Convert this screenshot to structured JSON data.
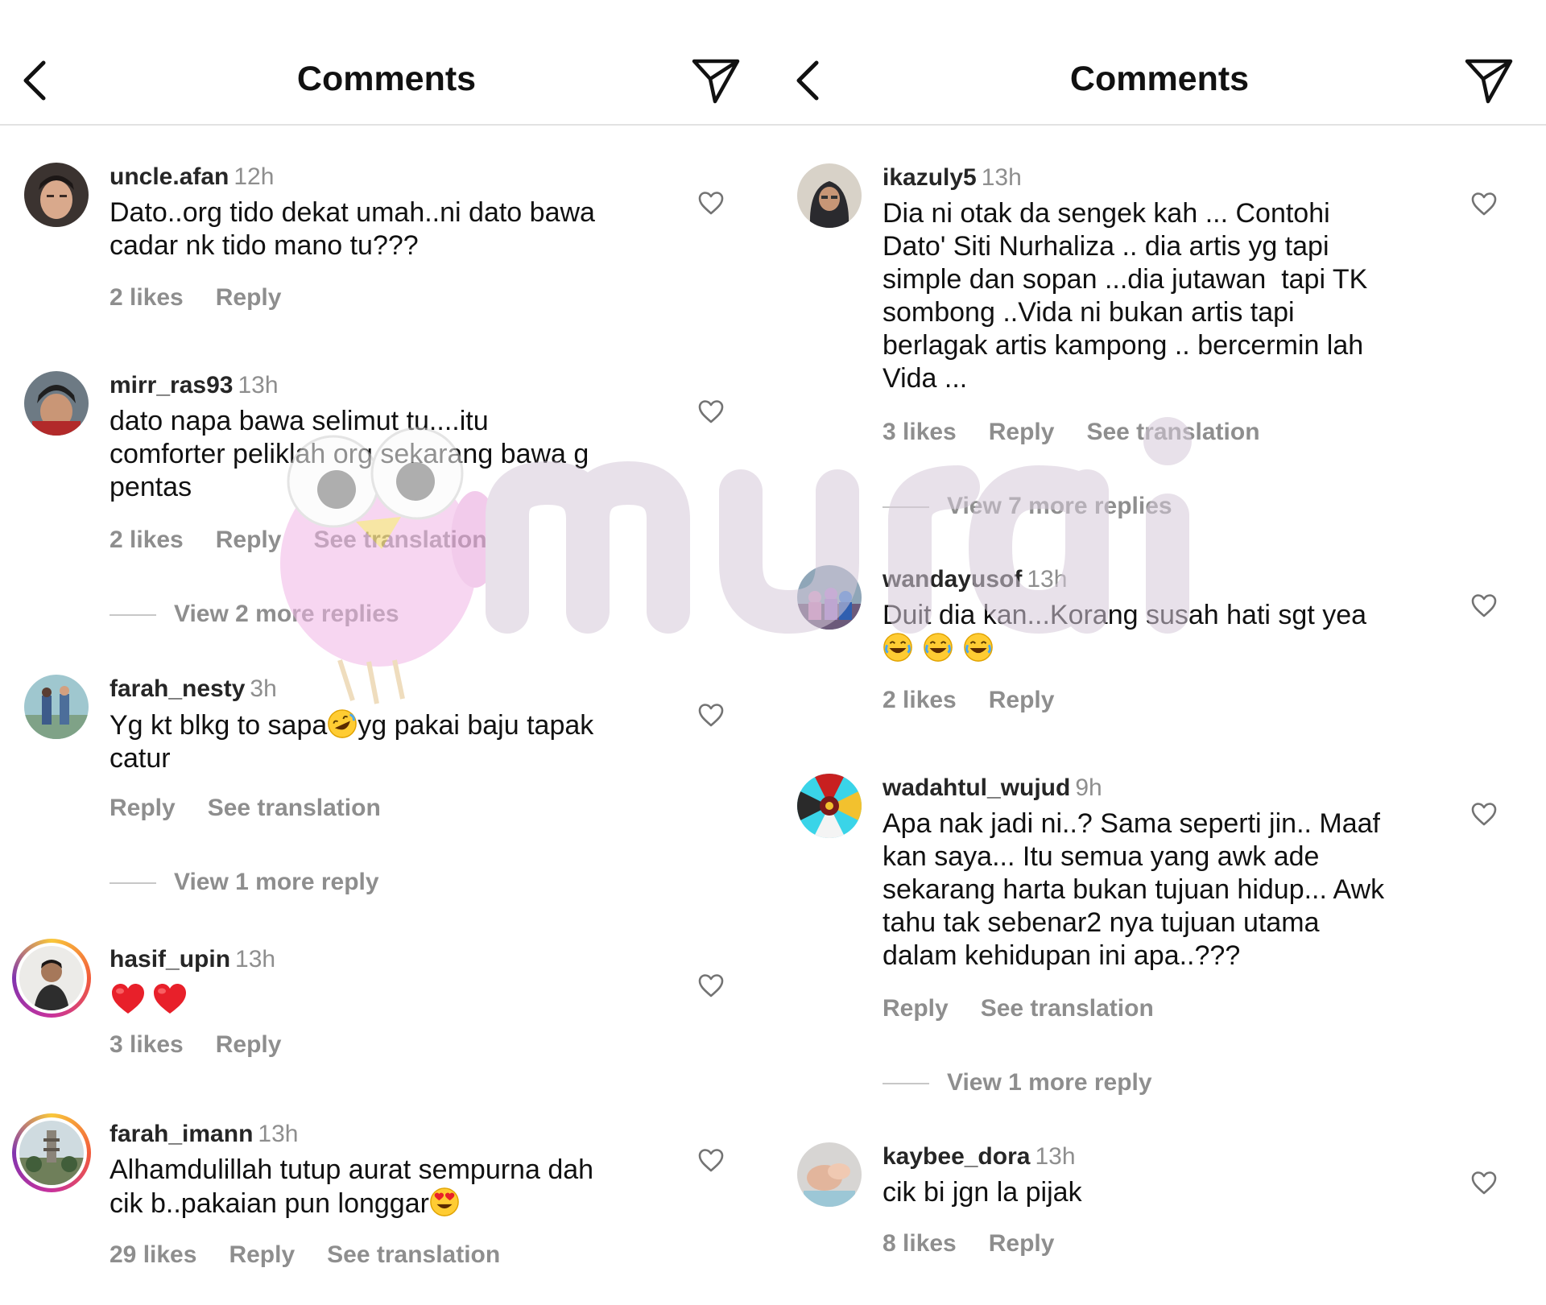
{
  "panels": [
    {
      "header": {
        "title": "Comments",
        "back_icon": "chevron-left-icon",
        "send_icon": "paper-plane-icon"
      },
      "comments": [
        {
          "user": "uncle.afan",
          "time": "12h",
          "text": "Dato..org tido dekat umah..ni dato bawa\ncadar nk tido mano tu???",
          "likes": "2 likes",
          "reply": "Reply",
          "translation": "",
          "more": ""
        },
        {
          "user": "mirr_ras93",
          "time": "13h",
          "text": "dato napa bawa selimut tu....itu\ncomforter peliklah org sekarang bawa g\npentas",
          "likes": "2 likes",
          "reply": "Reply",
          "translation": "See translation",
          "more": "View 2 more replies"
        },
        {
          "user": "farah_nesty",
          "time": "3h",
          "text_a": "Yg kt blkg to sapa",
          "text_b": "yg pakai baju tapak\ncatur",
          "likes": "",
          "reply": "Reply",
          "translation": "See translation",
          "more": "View 1 more reply"
        },
        {
          "user": "hasif_upin",
          "time": "13h",
          "likes": "3 likes",
          "reply": "Reply"
        },
        {
          "user": "farah_imann",
          "time": "13h",
          "text_a": "Alhamdulillah tutup aurat sempurna dah\ncik b..pakaian pun longgar",
          "likes": "29 likes",
          "reply": "Reply",
          "translation": "See translation"
        }
      ]
    },
    {
      "header": {
        "title": "Comments",
        "back_icon": "chevron-left-icon",
        "send_icon": "paper-plane-icon"
      },
      "comments": [
        {
          "user": "ikazuly5",
          "time": "13h",
          "text": "Dia ni otak da sengek kah ... Contohi\nDato' Siti Nurhaliza .. dia artis yg tapi\nsimple dan sopan ...dia jutawan  tapi TK\nsombong ..Vida ni bukan artis tapi\nberlagak artis kampong .. bercermin lah\nVida ...",
          "likes": "3 likes",
          "reply": "Reply",
          "translation": "See translation",
          "more": "View 7 more replies"
        },
        {
          "user": "wandayusof",
          "time": "13h",
          "text": "Duit dia kan...Korang susah hati sgt yea",
          "likes": "2 likes",
          "reply": "Reply"
        },
        {
          "user": "wadahtul_wujud",
          "time": "9h",
          "text": "Apa nak jadi ni..? Sama seperti jin.. Maaf\nkan saya... Itu semua yang awk ade\nsekarang harta bukan tujuan hidup... Awk\ntahu tak sebenar2 nya tujuan utama\ndalam kehidupan ini apa..???",
          "reply": "Reply",
          "translation": "See translation",
          "more": "View 1 more reply"
        },
        {
          "user": "kaybee_dora",
          "time": "13h",
          "text": "cik bi jgn la pijak",
          "likes": "8 likes",
          "reply": "Reply"
        }
      ]
    }
  ],
  "watermark": {
    "text": "murai",
    "color": "#d7c9dc"
  },
  "colors": {
    "text": "#111111",
    "muted": "#8e8e8e",
    "divider": "#e2e2e2"
  }
}
